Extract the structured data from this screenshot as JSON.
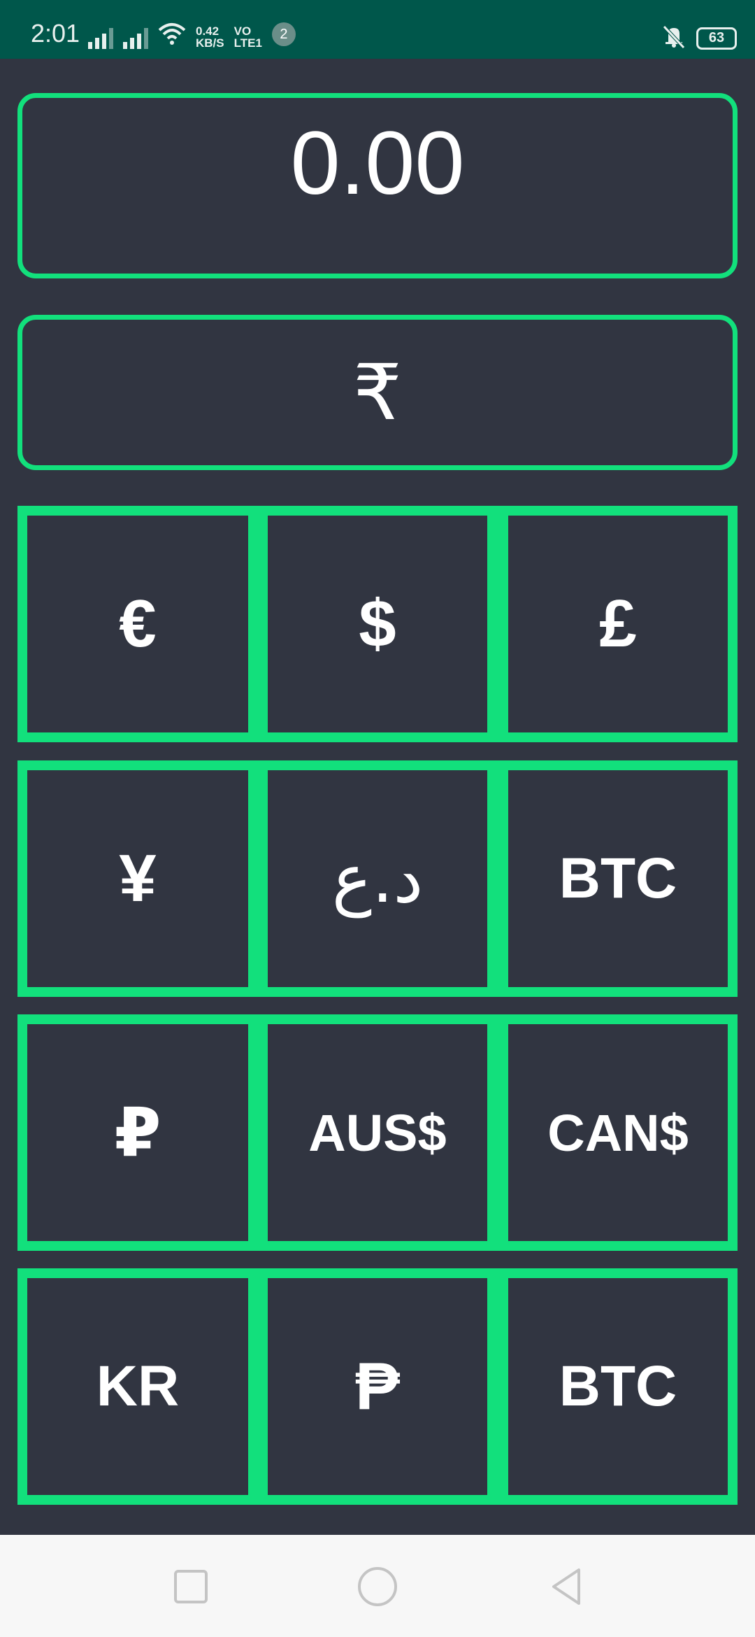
{
  "status_bar": {
    "time": "2:01",
    "speed_value": "0.42",
    "speed_unit": "KB/S",
    "volte_top": "VO",
    "volte_bottom": "LTE1",
    "notification_count": "2",
    "battery_level": "63",
    "icons": [
      "signal-icon",
      "signal-icon",
      "wifi-icon",
      "vibrate-icon",
      "battery-icon"
    ]
  },
  "display": {
    "amount": "0.00"
  },
  "base_currency": {
    "symbol": "₹"
  },
  "currency_grid": {
    "rows": [
      [
        "€",
        "$",
        "£"
      ],
      [
        "¥",
        "د.ع",
        "BTC"
      ],
      [
        "₽",
        "AUS$",
        "CAN$"
      ],
      [
        "KR",
        "₱",
        "BTC"
      ]
    ]
  },
  "colors": {
    "accent": "#12e07c",
    "background": "#313541",
    "status_bar": "#00574b",
    "nav_bar": "#f7f7f7"
  },
  "nav_bar": {
    "icons": [
      "recents-square-icon",
      "home-circle-icon",
      "back-triangle-icon"
    ]
  }
}
